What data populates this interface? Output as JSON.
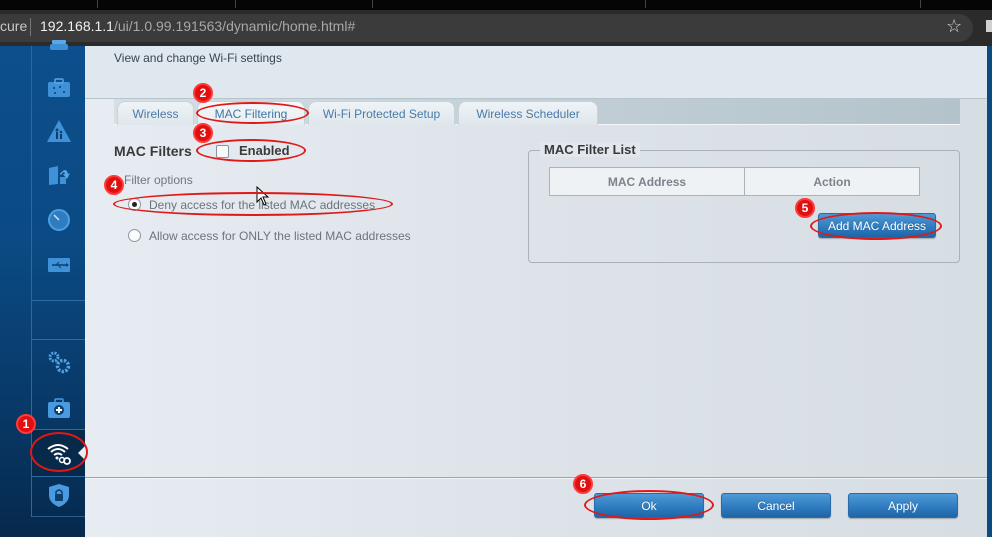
{
  "browser": {
    "security_label": "cure",
    "url_host": "192.168.1.1",
    "url_path": "/ui/1.0.99.191563/dynamic/home.html#",
    "bookmark_icon": "star-icon"
  },
  "sidebar": {
    "items": [
      {
        "name": "device-list",
        "icon": "device-icon"
      },
      {
        "name": "guest-access",
        "icon": "guest-network-icon"
      },
      {
        "name": "parental-controls",
        "icon": "parental-controls-icon"
      },
      {
        "name": "media-prioritization",
        "icon": "media-prioritization-icon"
      },
      {
        "name": "speed-test",
        "icon": "speedometer-icon"
      },
      {
        "name": "external-storage",
        "icon": "usb-icon"
      },
      {
        "name": "connectivity",
        "icon": "gears-icon"
      },
      {
        "name": "troubleshooting",
        "icon": "first-aid-kit-icon"
      },
      {
        "name": "wireless",
        "icon": "wifi-gear-icon",
        "active": true
      },
      {
        "name": "security",
        "icon": "lock-shield-icon"
      }
    ]
  },
  "page": {
    "subtitle": "View and change Wi-Fi settings"
  },
  "tabs": [
    {
      "label": "Wireless",
      "active": false
    },
    {
      "label": "MAC Filtering",
      "active": true
    },
    {
      "label": "Wi-Fi Protected Setup",
      "active": false
    },
    {
      "label": "Wireless Scheduler",
      "active": false
    }
  ],
  "mac_filters": {
    "label": "MAC Filters",
    "enabled_label": "Enabled",
    "enabled": false,
    "filter_options_label": "Filter options",
    "options": [
      {
        "label": "Deny access for the listed MAC addresses",
        "selected": true
      },
      {
        "label": "Allow access for ONLY the listed MAC addresses",
        "selected": false
      }
    ]
  },
  "mac_filter_list": {
    "title": "MAC Filter List",
    "columns": [
      "MAC Address",
      "Action"
    ],
    "rows": [],
    "add_button": "Add MAC Address"
  },
  "footer": {
    "ok": "Ok",
    "cancel": "Cancel",
    "apply": "Apply"
  },
  "annotations": [
    "1",
    "2",
    "3",
    "4",
    "5",
    "6"
  ],
  "colors": {
    "accent": "#2f7cc0",
    "sidebar": "#0b4a84",
    "annotation": "#e01818"
  }
}
